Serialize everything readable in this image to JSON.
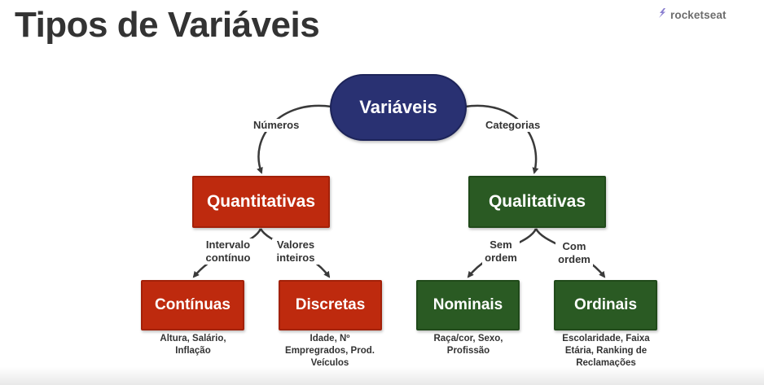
{
  "header": {
    "title": "Tipos de Variáveis",
    "brand": "rocketseat",
    "brand_icon": "rocket-bolt-icon"
  },
  "diagram": {
    "root": {
      "label": "Variáveis",
      "color": "#293172"
    },
    "left_branch": {
      "edge_label": "Números",
      "node": {
        "label": "Quantitativas",
        "color": "#be2a0e"
      },
      "children": [
        {
          "edge_label": "Intervalo contínuo",
          "label": "Contínuas",
          "examples": "Altura, Salário, Inflação"
        },
        {
          "edge_label": "Valores inteiros",
          "label": "Discretas",
          "examples": "Idade, Nº Empregrados, Prod. Veículos"
        }
      ]
    },
    "right_branch": {
      "edge_label": "Categorias",
      "node": {
        "label": "Qualitativas",
        "color": "#2a5a23"
      },
      "children": [
        {
          "edge_label": "Sem ordem",
          "label": "Nominais",
          "examples": "Raça/cor, Sexo, Profissão"
        },
        {
          "edge_label": "Com ordem",
          "label": "Ordinais",
          "examples": "Escolaridade, Faixa Etária, Ranking de Reclamações"
        }
      ]
    }
  }
}
